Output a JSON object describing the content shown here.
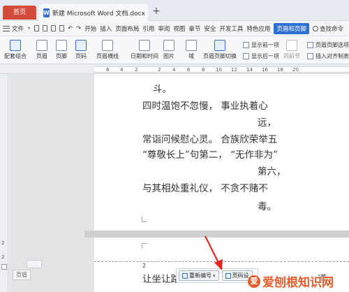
{
  "tabbar": {
    "home_label": "首页",
    "doc_title": "新建 Microsoft Word 文档.docx",
    "doc_icon": "W",
    "new_tab": "+"
  },
  "menubar": {
    "file_label": "文件",
    "items": [
      "开始",
      "插入",
      "页面布局",
      "引用",
      "审阅",
      "视图",
      "章节",
      "安全",
      "开发工具",
      "特色应用"
    ],
    "active_item": "页眉和页脚",
    "search_label": "查找命令"
  },
  "ribbon": {
    "page_number_group": "配套组合",
    "header": "页眉",
    "footer": "页脚",
    "page_num": "页码",
    "header_line": "页眉横线",
    "datetime": "日期和时间",
    "picture": "图片",
    "field": "域",
    "switch_hf": "页眉页脚切换",
    "show_prev": "显示前一项",
    "show_next": "显示后一项",
    "same_prev": "同前节",
    "hf_options": "页眉页脚选项",
    "insert_align_tab": "插入对齐制表"
  },
  "ruler": {
    "numbers": [
      "6",
      "4",
      "2",
      "2",
      "4",
      "6",
      "8",
      "10",
      "12",
      "14",
      "16",
      "18",
      "20"
    ]
  },
  "vruler": {
    "numbers": [
      "2",
      "2"
    ]
  },
  "document": {
    "lines": [
      "斗。",
      "四时温饱不忽慢，          事业执着心",
      "远，",
      "常诣问候慰心灵。          合族欣荣举五",
      "“尊敬长上”句第二，        “无作非为”",
      "第六，",
      "与其相处重礼仪，          不贪不赌不",
      "毒。"
    ],
    "page2_line": "让坐让路",
    "page2_tail": "遵",
    "page_marker": "2",
    "footer_label": "页眉"
  },
  "footer_toolbar": {
    "renumber_label": "重新编号",
    "page_setting_label": "页码设"
  },
  "watermark": {
    "logo_char": "爱",
    "text": "爱刨根知识网"
  },
  "colors": {
    "accent": "#2f6fd4",
    "home_tab": "#d44b3a",
    "arrow": "#e0271f",
    "watermark": "#e85c2a"
  }
}
